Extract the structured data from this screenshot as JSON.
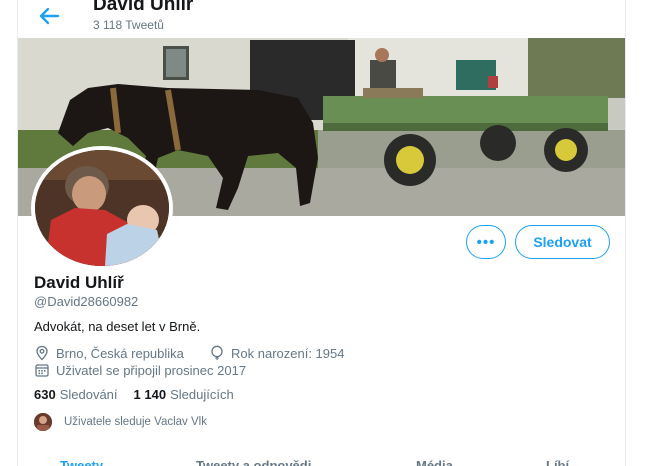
{
  "header": {
    "title": "David Uhlíř",
    "tweet_count": "3 118 Tweetů"
  },
  "profile": {
    "name": "David Uhlíř",
    "handle": "@David28660982",
    "bio": "Advokát, na deset let v Brně.",
    "location": "Brno, Česká republika",
    "birth": "Rok narození: 1954",
    "joined": "Uživatel se připojil prosinec 2017"
  },
  "actions": {
    "more_label": "•••",
    "follow_label": "Sledovat"
  },
  "stats": {
    "following_count": "630",
    "following_label": "Sledování",
    "followers_count": "1 140",
    "followers_label": "Sledujících"
  },
  "followed_by": "Uživatele sleduje Vaclav Vlk",
  "tabs": [
    {
      "label": "Tweety"
    },
    {
      "label": "Tweety a odpovědi"
    },
    {
      "label": "Média"
    },
    {
      "label": "Líbí"
    }
  ],
  "colors": {
    "accent": "#1da1f2",
    "secondary_text": "#657786",
    "primary_text": "#14171a"
  }
}
